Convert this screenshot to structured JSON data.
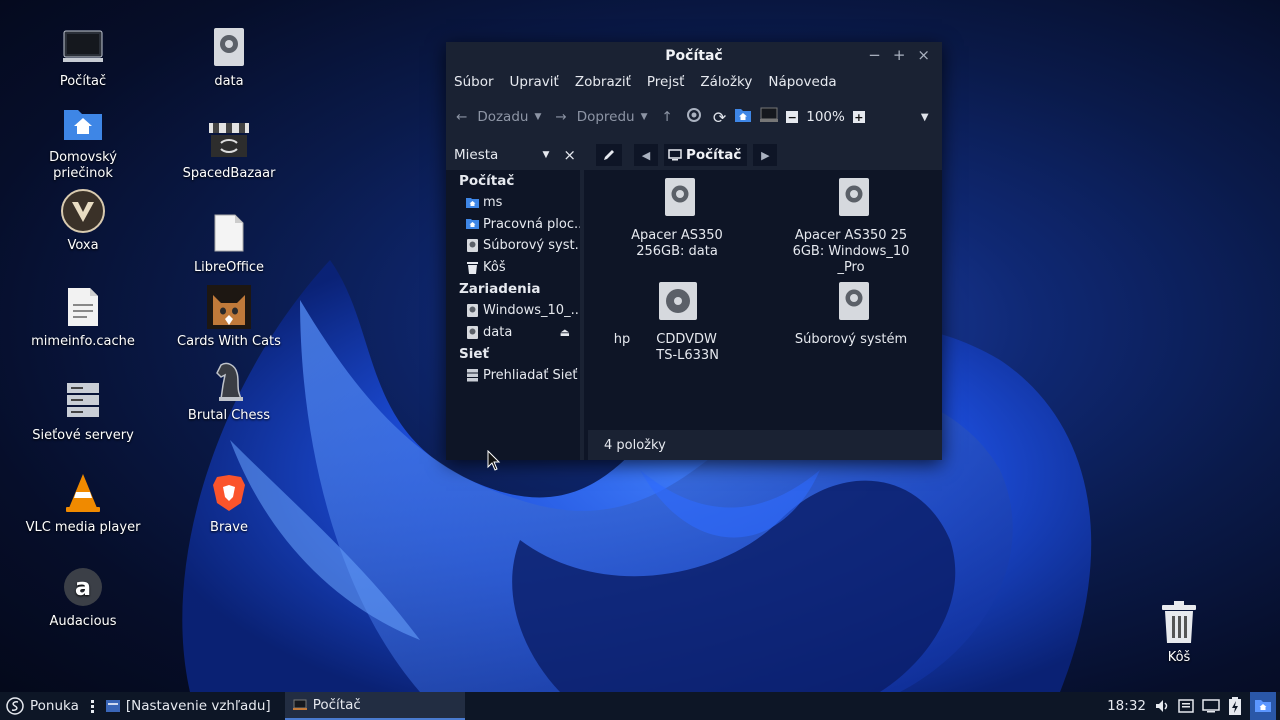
{
  "desktop": {
    "icons": [
      {
        "label": "Počítač",
        "icon": "computer-icon"
      },
      {
        "label": "Domovský priečinok",
        "icon": "home-folder-icon"
      },
      {
        "label": "Voxa",
        "icon": "voxa-icon"
      },
      {
        "label": "mimeinfo.cache",
        "icon": "text-file-icon"
      },
      {
        "label": "Sieťové servery",
        "icon": "network-servers-icon"
      },
      {
        "label": "VLC media player",
        "icon": "vlc-icon"
      },
      {
        "label": "Audacious",
        "icon": "audacious-icon"
      },
      {
        "label": "data",
        "icon": "drive-icon"
      },
      {
        "label": "SpacedBazaar",
        "icon": "spacedbazaar-icon"
      },
      {
        "label": "LibreOffice",
        "icon": "libreoffice-icon"
      },
      {
        "label": "Cards With Cats",
        "icon": "cat-icon"
      },
      {
        "label": "Brutal Chess",
        "icon": "chess-knight-icon"
      },
      {
        "label": "Brave",
        "icon": "brave-icon"
      },
      {
        "label": "Kôš",
        "icon": "trash-icon"
      }
    ]
  },
  "window": {
    "title": "Počítač",
    "menu": [
      "Súbor",
      "Upraviť",
      "Zobraziť",
      "Prejsť",
      "Záložky",
      "Nápoveda"
    ],
    "toolbar": {
      "back": "Dozadu",
      "forward": "Dopredu",
      "zoom": "100%"
    },
    "sidebar_title": "Miesta",
    "path": "Počítač",
    "sidebar": {
      "sections": [
        {
          "title": "Počítač",
          "items": [
            "ms",
            "Pracovná ploc...",
            "Súborový syst...",
            "Kôš"
          ]
        },
        {
          "title": "Zariadenia",
          "items": [
            "Windows_10_...",
            "data"
          ]
        },
        {
          "title": "Sieť",
          "items": [
            "Prehliadať Sieť"
          ]
        }
      ]
    },
    "items": [
      {
        "label": "Apacer AS350 256GB: data"
      },
      {
        "label": "Apacer AS350 256GB: Windows_10_Pro"
      },
      {
        "prefix": "hp",
        "label": "CDDVDW TS-L633N"
      },
      {
        "label": "Súborový systém"
      }
    ],
    "status": "4 položky"
  },
  "taskbar": {
    "menu": "Ponuka",
    "tasks": [
      "[Nastavenie vzhľadu]",
      "Počítač"
    ],
    "clock": "18:32"
  },
  "colors": {
    "accent": "#4a7bd0",
    "window_bg": "#0e1526",
    "panel_bg": "#1a2233"
  }
}
